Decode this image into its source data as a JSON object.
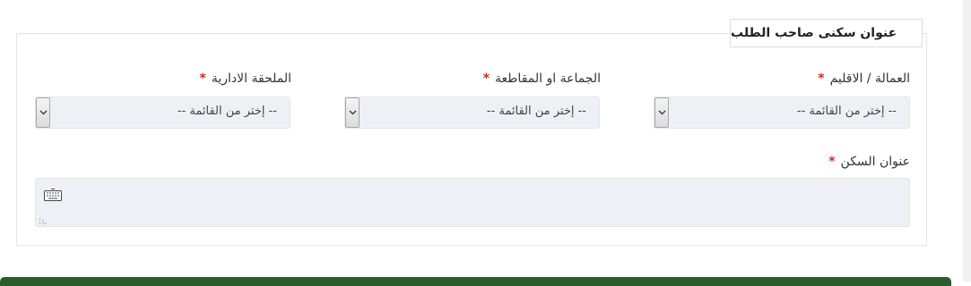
{
  "section_title": "عنوان سكنى صاحب الطلب",
  "required_mark": "*",
  "fields": {
    "province": {
      "label": "العمالة / الاقليم",
      "value": "-- إختر من القائمة --"
    },
    "commune": {
      "label": "الجماعة او المقاطعة",
      "value": "-- إختر من القائمة --"
    },
    "annex": {
      "label": "الملحقة الادارية",
      "value": "-- إختر من القائمة --"
    },
    "address": {
      "label": "عنوان السكن",
      "value": ""
    }
  },
  "colors": {
    "required": "#d9261c",
    "footer_bar": "#2a5d2c",
    "field_bg": "#eef0f5"
  },
  "icons": [
    "chevron-down-icon",
    "keyboard-icon",
    "resize-grip-icon"
  ]
}
